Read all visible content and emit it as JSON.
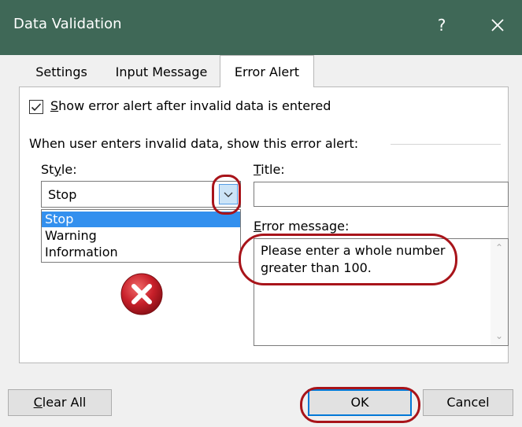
{
  "window": {
    "title": "Data Validation",
    "help_label": "?",
    "titlebar_color": "#3f6857"
  },
  "tabs": [
    {
      "label": "Settings",
      "active": false
    },
    {
      "label": "Input Message",
      "active": false
    },
    {
      "label": "Error Alert",
      "active": true
    }
  ],
  "error_alert": {
    "show_checkbox": {
      "label": "Show error alert after invalid data is entered",
      "checked": true
    },
    "group_label": "When user enters invalid data, show this error alert:",
    "style": {
      "label": "Style:",
      "value": "Stop",
      "options": [
        "Stop",
        "Warning",
        "Information"
      ],
      "selected_option": "Stop"
    },
    "title_field": {
      "label": "Title:",
      "value": ""
    },
    "error_message": {
      "label": "Error message:",
      "value": "Please enter a whole number greater than 100."
    },
    "style_icon": "stop-error-icon"
  },
  "buttons": {
    "clear_all": "Clear All",
    "ok": "OK",
    "cancel": "Cancel"
  },
  "colors": {
    "selection": "#3390ee",
    "annotation": "#a8141a",
    "stop_icon": "#c8202a",
    "focus_border": "#0078d7"
  }
}
